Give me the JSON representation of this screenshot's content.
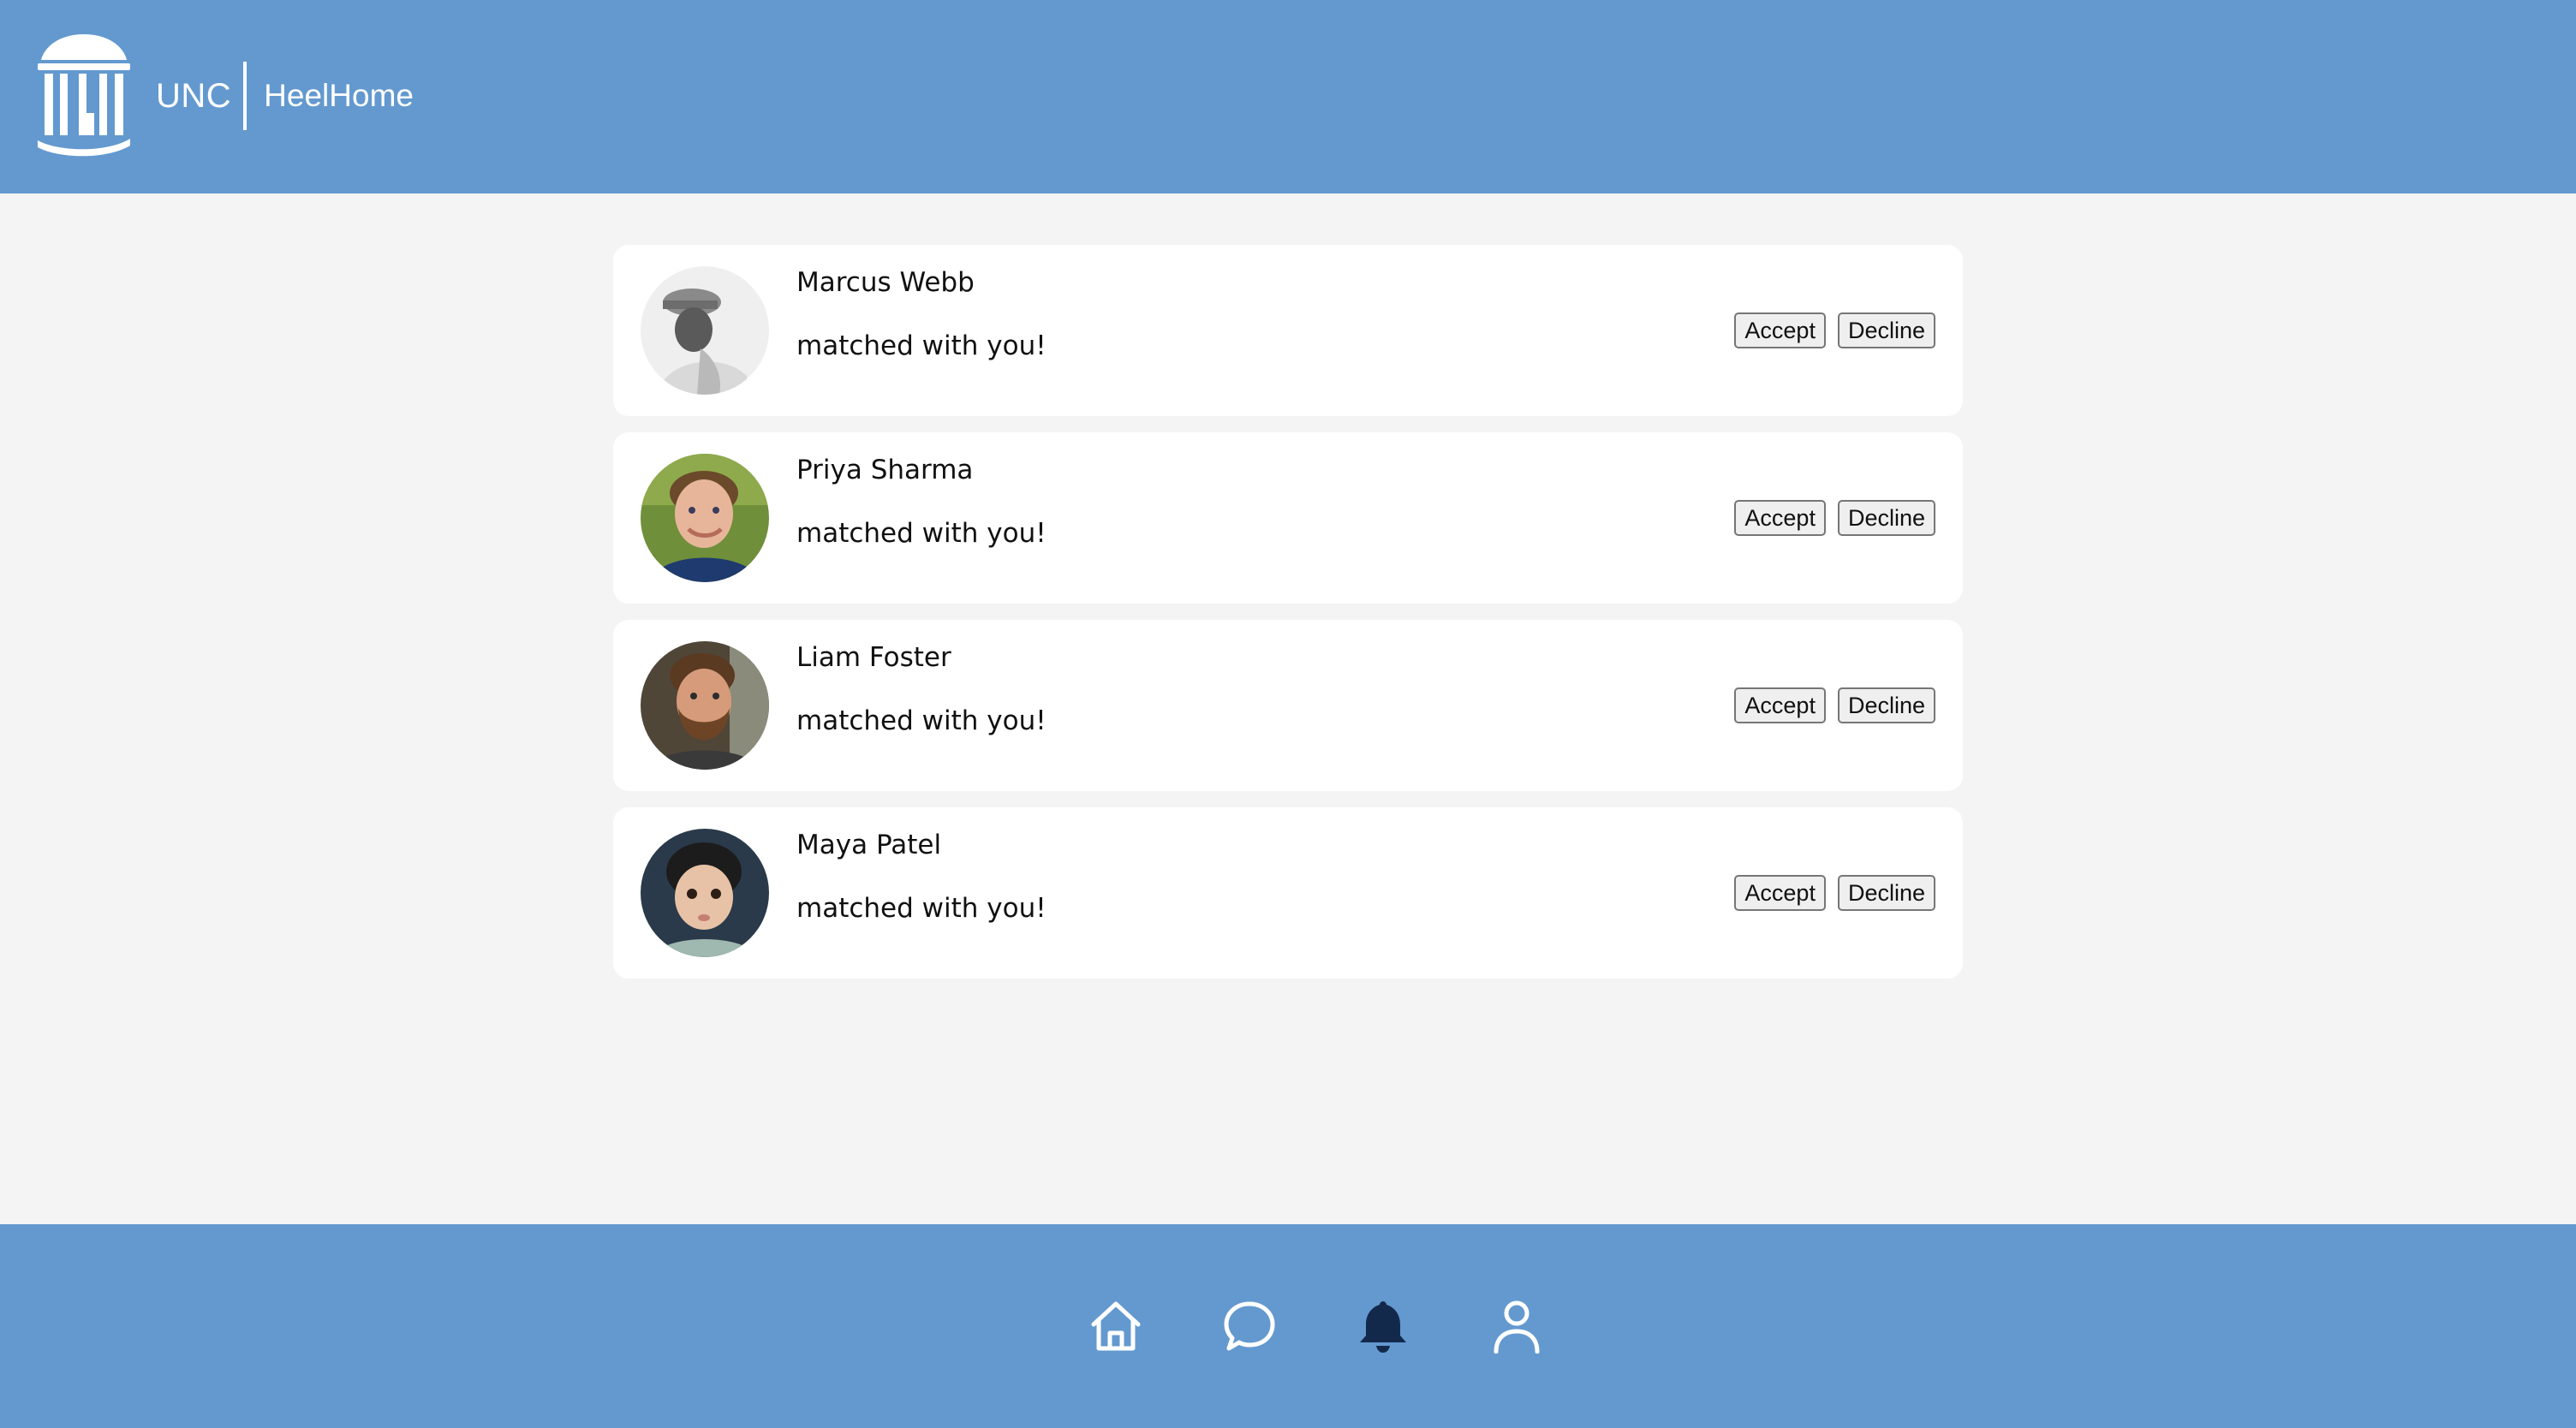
{
  "header": {
    "brand_unc": "UNC",
    "brand_app": "HeelHome",
    "logo_icon": "old-well-icon",
    "background": "#6399cf"
  },
  "notifications": [
    {
      "name": "Marcus Webb",
      "message": "matched with you!",
      "accept_label": "Accept",
      "decline_label": "Decline",
      "avatar_icon": "profile-photo"
    },
    {
      "name": "Priya Sharma",
      "message": "matched with you!",
      "accept_label": "Accept",
      "decline_label": "Decline",
      "avatar_icon": "profile-photo"
    },
    {
      "name": "Liam Foster",
      "message": "matched with you!",
      "accept_label": "Accept",
      "decline_label": "Decline",
      "avatar_icon": "profile-photo"
    },
    {
      "name": "Maya Patel",
      "message": "matched with you!",
      "accept_label": "Accept",
      "decline_label": "Decline",
      "avatar_icon": "profile-photo"
    }
  ],
  "bottom_nav": {
    "items": [
      {
        "icon": "home-icon",
        "active": false
      },
      {
        "icon": "chat-icon",
        "active": false
      },
      {
        "icon": "bell-icon",
        "active": true
      },
      {
        "icon": "profile-icon",
        "active": false
      }
    ],
    "active_color": "#13294b",
    "inactive_color": "#ffffff"
  }
}
